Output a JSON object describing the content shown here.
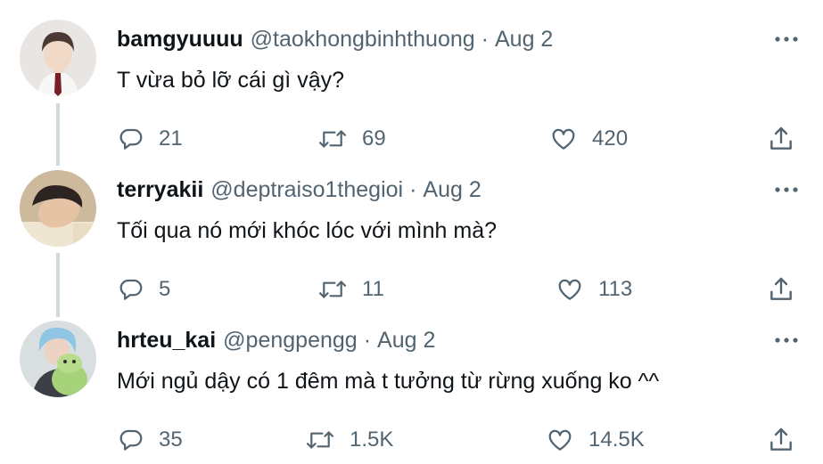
{
  "tweets": [
    {
      "display_name": "bamgyuuuu",
      "handle": "@taokhongbinhthuong",
      "separator": "·",
      "date": "Aug 2",
      "text": "T vừa bỏ lỡ cái gì vậy?",
      "replies": "21",
      "retweets": "69",
      "likes": "420"
    },
    {
      "display_name": "terryakii",
      "handle": "@deptraiso1thegioi",
      "separator": "·",
      "date": "Aug 2",
      "text": "Tối qua nó mới khóc lóc với mình mà?",
      "replies": "5",
      "retweets": "11",
      "likes": "113"
    },
    {
      "display_name": "hrteu_kai",
      "handle": "@pengpengg",
      "separator": "·",
      "date": "Aug 2",
      "text": "Mới ngủ dậy có 1 đêm mà t tưởng từ rừng xuống ko ^^",
      "replies": "35",
      "retweets": "1.5K",
      "likes": "14.5K"
    }
  ],
  "icons": {
    "more": "more-horizontal-icon",
    "reply": "reply-bubble-icon",
    "retweet": "retweet-icon",
    "like": "heart-icon",
    "share": "share-icon"
  },
  "colors": {
    "text_primary": "#0f1419",
    "text_secondary": "#536471",
    "thread_line": "#cfd9de",
    "background": "#ffffff"
  }
}
